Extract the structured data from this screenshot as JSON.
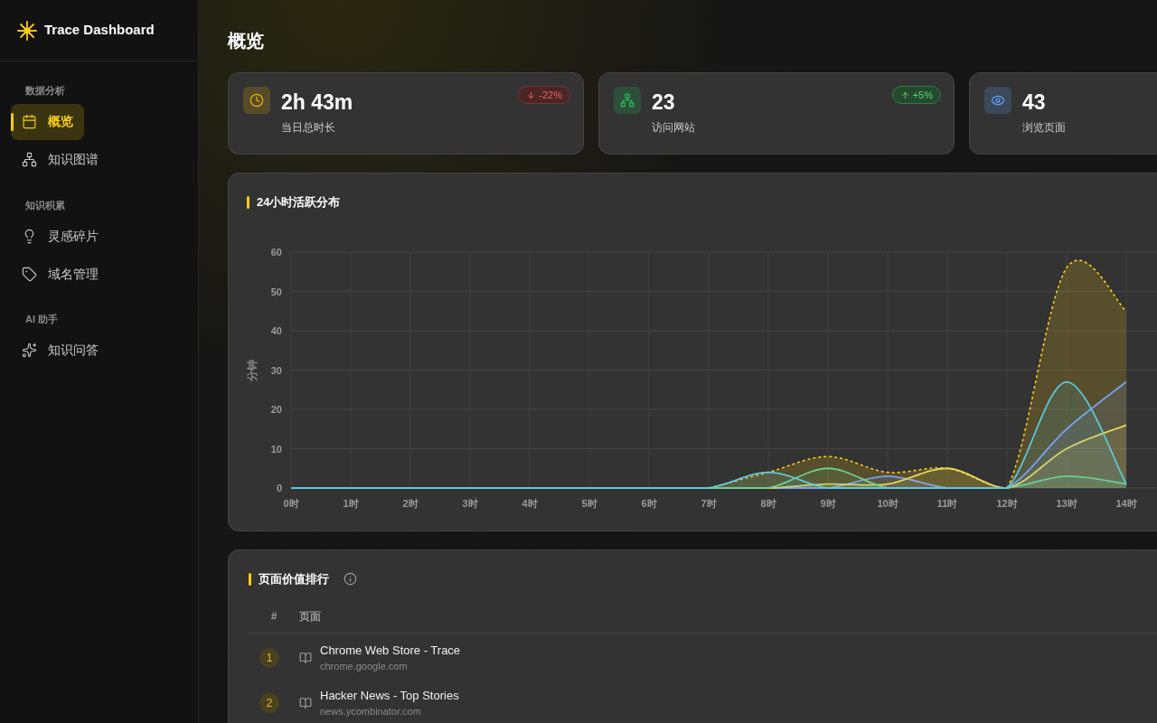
{
  "brand": {
    "name": "Trace Dashboard"
  },
  "sidebar": {
    "sections": [
      {
        "title": "数据分析",
        "items": [
          {
            "label": "概览",
            "selected": true
          },
          {
            "label": "知识图谱",
            "selected": false
          }
        ]
      },
      {
        "title": "知识积累",
        "items": [
          {
            "label": "灵感碎片",
            "selected": false
          },
          {
            "label": "域名管理",
            "selected": false
          }
        ]
      },
      {
        "title": "AI 助手",
        "items": [
          {
            "label": "知识问答",
            "selected": false
          }
        ]
      }
    ]
  },
  "page": {
    "title": "概览"
  },
  "stats": [
    {
      "value": "2h 43m",
      "label": "当日总时长",
      "change": "-22%",
      "kind": "down"
    },
    {
      "value": "23",
      "label": "访问网站",
      "change": "+5%",
      "kind": "up"
    },
    {
      "value": "43",
      "label": "浏览页面"
    }
  ],
  "activity": {
    "title": "24小时活跃分布",
    "chart_data": {
      "type": "line",
      "ylabel": "分钟",
      "grid": true,
      "categories": [
        "0时",
        "1时",
        "2时",
        "3时",
        "4时",
        "5时",
        "6时",
        "7时",
        "8时",
        "9时",
        "10时",
        "11时",
        "12时",
        "13时",
        "14时"
      ],
      "ylim": [
        0,
        60
      ],
      "yticks": [
        0,
        10,
        20,
        30,
        40,
        50,
        60
      ],
      "series": [
        {
          "color": "#facc15",
          "line_style": "dashed",
          "values": [
            null,
            null,
            null,
            null,
            null,
            null,
            null,
            0,
            4,
            8,
            4,
            5,
            0,
            56,
            45
          ]
        },
        {
          "color": "#7c9ff0",
          "line_style": "solid",
          "values": [
            null,
            null,
            null,
            null,
            null,
            null,
            null,
            0,
            0,
            0,
            3,
            0,
            0,
            15,
            27
          ]
        },
        {
          "color": "#e6d45a",
          "line_style": "solid",
          "values": [
            null,
            null,
            null,
            null,
            null,
            null,
            null,
            0,
            0,
            1,
            1,
            5,
            0,
            10,
            16
          ]
        },
        {
          "color": "#6fcf8a",
          "line_style": "solid",
          "values": [
            null,
            null,
            null,
            null,
            null,
            null,
            null,
            0,
            0,
            5,
            0,
            0,
            0,
            3,
            1
          ]
        },
        {
          "color": "#5ec8dc",
          "line_style": "solid",
          "values": [
            0,
            0,
            0,
            0,
            0,
            0,
            0,
            0,
            4,
            0,
            0,
            0,
            0,
            27,
            1
          ]
        }
      ]
    }
  },
  "ranking": {
    "title": "页面价值排行",
    "columns": [
      "#",
      "页面"
    ],
    "rows": [
      {
        "rank": "1",
        "title": "Chrome Web Store - Trace",
        "domain": "chrome.google.com"
      },
      {
        "rank": "2",
        "title": "Hacker News - Top Stories",
        "domain": "news.ycombinator.com"
      }
    ]
  }
}
